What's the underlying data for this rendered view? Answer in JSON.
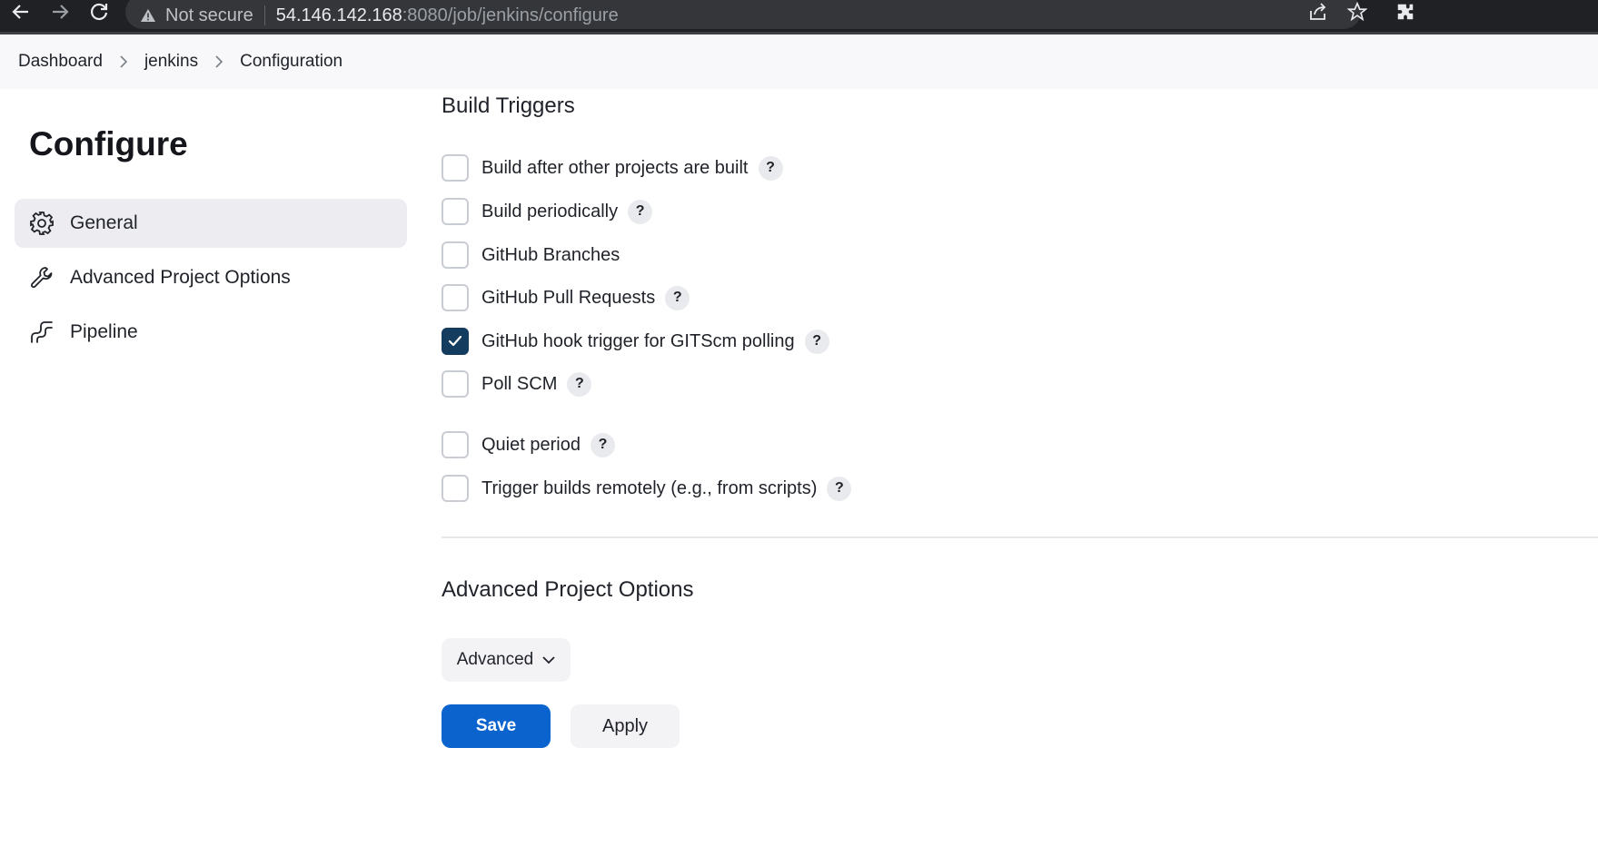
{
  "browser": {
    "security_label": "Not secure",
    "url_host": "54.146.142.168",
    "url_path": ":8080/job/jenkins/configure"
  },
  "breadcrumb": [
    "Dashboard",
    "jenkins",
    "Configuration"
  ],
  "sidebar": {
    "title": "Configure",
    "items": [
      {
        "label": "General",
        "icon": "gear-icon",
        "active": true
      },
      {
        "label": "Advanced Project Options",
        "icon": "wrench-icon",
        "active": false
      },
      {
        "label": "Pipeline",
        "icon": "pipeline-icon",
        "active": false
      }
    ]
  },
  "build_triggers": {
    "title": "Build Triggers",
    "options": [
      {
        "label": "Build after other projects are built",
        "checked": false,
        "help": "?"
      },
      {
        "label": "Build periodically",
        "checked": false,
        "help": "?"
      },
      {
        "label": "GitHub Branches",
        "checked": false
      },
      {
        "label": "GitHub Pull Requests",
        "checked": false,
        "help": "?"
      },
      {
        "label": "GitHub hook trigger for GITScm polling",
        "checked": true,
        "help": "?"
      },
      {
        "label": "Poll SCM",
        "checked": false,
        "help": "?"
      },
      {
        "label": "Quiet period",
        "checked": false,
        "help": "?"
      },
      {
        "label": "Trigger builds remotely (e.g., from scripts)",
        "checked": false,
        "help": "?"
      }
    ]
  },
  "advanced_options": {
    "title": "Advanced Project Options",
    "button_label": "Advanced"
  },
  "actions": {
    "save_label": "Save",
    "apply_label": "Apply"
  },
  "colors": {
    "primary": "#0b63ce",
    "checked": "#143c5e"
  }
}
